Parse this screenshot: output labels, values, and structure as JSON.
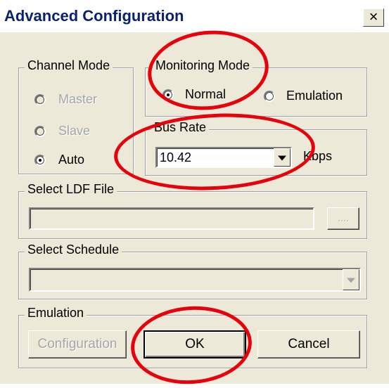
{
  "window": {
    "title": "Advanced Configuration",
    "close_label": "×"
  },
  "channel_mode": {
    "legend": "Channel Mode",
    "options": [
      {
        "label": "Master",
        "selected": false,
        "enabled": false
      },
      {
        "label": "Slave",
        "selected": false,
        "enabled": false
      },
      {
        "label": "Auto",
        "selected": true,
        "enabled": true
      }
    ]
  },
  "monitoring_mode": {
    "legend": "Monitoring Mode",
    "options": [
      {
        "label": "Normal",
        "selected": true,
        "enabled": true
      },
      {
        "label": "Emulation",
        "selected": false,
        "enabled": true
      }
    ]
  },
  "bus_rate": {
    "legend": "Bus Rate",
    "value": "10.42",
    "unit": "Kbps"
  },
  "ldf_file": {
    "legend": "Select LDF File",
    "value": "",
    "browse_label": "...."
  },
  "schedule": {
    "legend": "Select Schedule",
    "value": ""
  },
  "emulation": {
    "legend": "Emulation",
    "configuration_label": "Configuration"
  },
  "buttons": {
    "ok": "OK",
    "cancel": "Cancel"
  },
  "annotations": {
    "ring_color": "#e8000b"
  }
}
